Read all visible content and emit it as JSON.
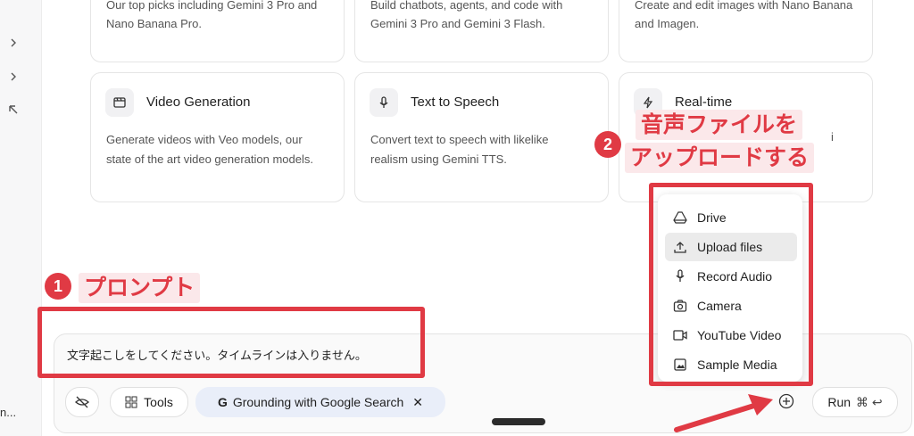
{
  "sidebar": {
    "icons": [
      "chevron-right-icon",
      "chevron-right-icon",
      "arrow-up-left-icon"
    ],
    "truncated_label": "n..."
  },
  "cards_top": [
    {
      "text_line1": "Our top picks including Gemini 3 Pro and",
      "text_line2": "Nano Banana Pro."
    },
    {
      "text_line1": "Build chatbots, agents, and code with",
      "text_line2": "Gemini 3 Pro and Gemini 3 Flash."
    },
    {
      "text_line1": "Create and edit images with Nano Banana",
      "text_line2": "and Imagen."
    }
  ],
  "cards": [
    {
      "title": "Video Generation",
      "desc_line1": "Generate videos with Veo models, our",
      "desc_line2": "state of the art video generation models.",
      "icon": "video-icon"
    },
    {
      "title": "Text to Speech",
      "desc_line1": "Convert text to speech with likelike",
      "desc_line2": "realism using Gemini TTS.",
      "icon": "microphone-icon"
    },
    {
      "title": "Real-time",
      "desc_line1": "",
      "desc_line2": "",
      "icon": "bolt-icon",
      "partial_tail": "i"
    }
  ],
  "composer": {
    "prompt": "文字起こしをしてください。タイムラインは入りません。",
    "tools_label": "Tools",
    "grounding_label": "Grounding with Google Search",
    "run_label": "Run",
    "run_shortcut": "⌘ ↩"
  },
  "menu": {
    "items": [
      {
        "label": "Drive",
        "icon": "drive-icon"
      },
      {
        "label": "Upload files",
        "icon": "upload-icon",
        "active": true
      },
      {
        "label": "Record Audio",
        "icon": "microphone-icon"
      },
      {
        "label": "Camera",
        "icon": "camera-icon"
      },
      {
        "label": "YouTube Video",
        "icon": "youtube-video-icon"
      },
      {
        "label": "Sample Media",
        "icon": "image-icon"
      }
    ]
  },
  "annotations": {
    "badge1": "1",
    "label1": "プロンプト",
    "badge2": "2",
    "label2_line1": "音声ファイルを",
    "label2_line2": "アップロードする"
  },
  "colors": {
    "annotation_red": "#e03a44",
    "chip_blue": "#e9eef9",
    "menu_active": "#ebebeb"
  }
}
